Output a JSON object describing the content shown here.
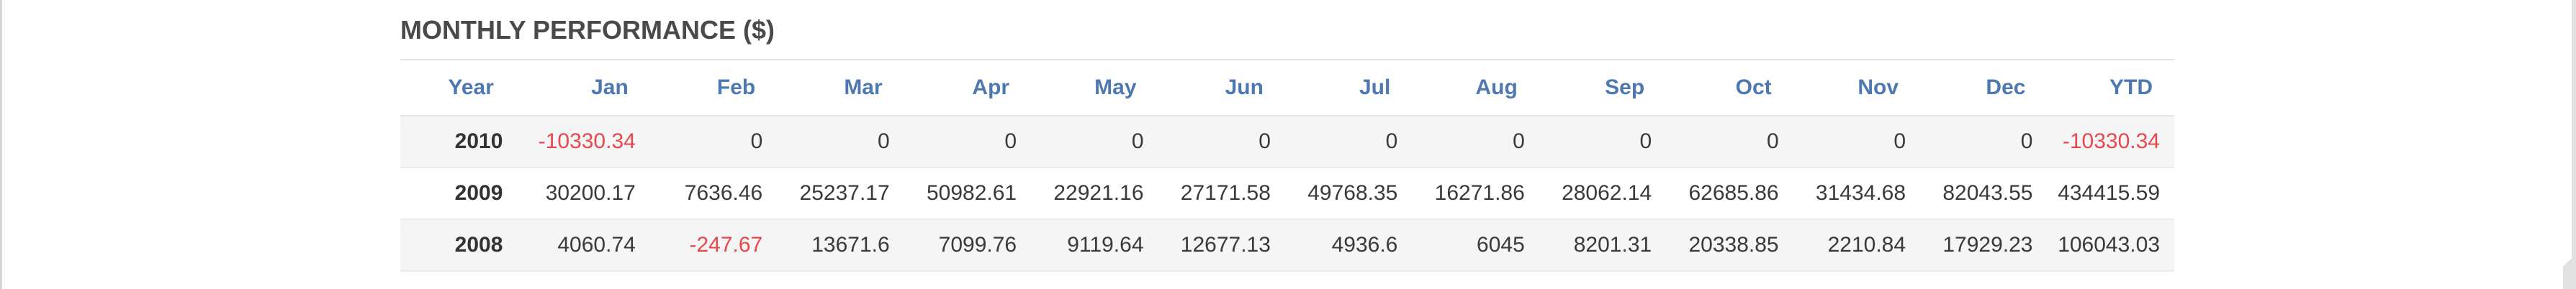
{
  "panel": {
    "title": "MONTHLY PERFORMANCE ($)"
  },
  "colors": {
    "header_text": "#4d79b0",
    "negative_value": "#e8474c",
    "row_shade": "#f5f5f5"
  },
  "table": {
    "columns": [
      "Year",
      "Jan",
      "Feb",
      "Mar",
      "Apr",
      "May",
      "Jun",
      "Jul",
      "Aug",
      "Sep",
      "Oct",
      "Nov",
      "Dec",
      "YTD"
    ],
    "rows": [
      {
        "year": "2010",
        "values": [
          "-10330.34",
          "0",
          "0",
          "0",
          "0",
          "0",
          "0",
          "0",
          "0",
          "0",
          "0",
          "0",
          "-10330.34"
        ]
      },
      {
        "year": "2009",
        "values": [
          "30200.17",
          "7636.46",
          "25237.17",
          "50982.61",
          "22921.16",
          "27171.58",
          "49768.35",
          "16271.86",
          "28062.14",
          "62685.86",
          "31434.68",
          "82043.55",
          "434415.59"
        ]
      },
      {
        "year": "2008",
        "values": [
          "4060.74",
          "-247.67",
          "13671.6",
          "7099.76",
          "9119.64",
          "12677.13",
          "4936.6",
          "6045",
          "8201.31",
          "20338.85",
          "2210.84",
          "17929.23",
          "106043.03"
        ]
      }
    ]
  }
}
